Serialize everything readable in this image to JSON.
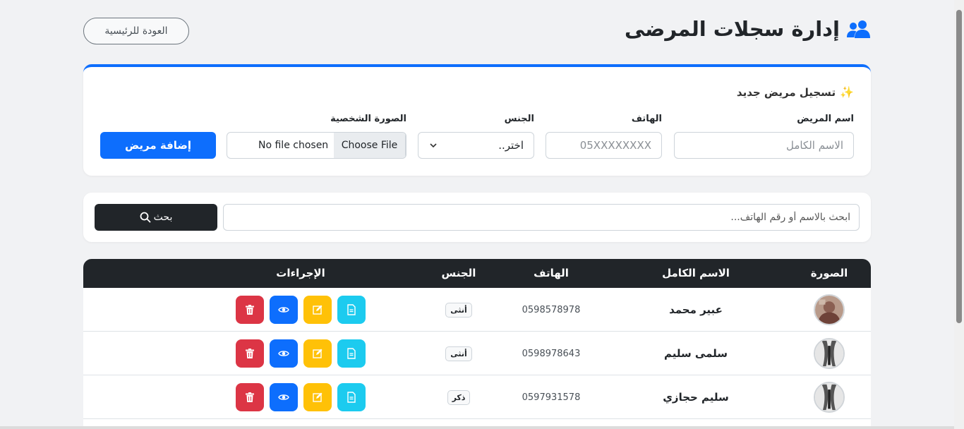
{
  "header": {
    "title": "إدارة سجلات المرضى",
    "back_label": "العودة للرئيسية"
  },
  "form": {
    "title": "تسجيل مريض جديد",
    "name_label": "اسم المريض",
    "name_placeholder": "الاسم الكامل",
    "phone_label": "الهاتف",
    "phone_placeholder": "05XXXXXXXX",
    "gender_label": "الجنس",
    "gender_selected": "اختر..",
    "photo_label": "الصورة الشخصية",
    "choose_file": "Choose File",
    "no_file": "No file chosen",
    "submit_label": "إضافة مريض"
  },
  "search": {
    "placeholder": "ابحث بالاسم أو رقم الهاتف...",
    "button_label": "بحث"
  },
  "table": {
    "headers": {
      "photo": "الصورة",
      "name": "الاسم الكامل",
      "phone": "الهاتف",
      "gender": "الجنس",
      "actions": "الإجراءات"
    },
    "rows": [
      {
        "name": "عبير محمد",
        "phone": "0598578978",
        "gender": "أنثى"
      },
      {
        "name": "سلمى سليم",
        "phone": "0598978643",
        "gender": "أنثى"
      },
      {
        "name": "سليم حجازي",
        "phone": "0597931578",
        "gender": "ذكر"
      }
    ]
  },
  "colors": {
    "primary": "#0d6efd",
    "dark": "#212529",
    "info": "#1ccbef",
    "warning": "#ffc107",
    "danger": "#dc3545"
  }
}
